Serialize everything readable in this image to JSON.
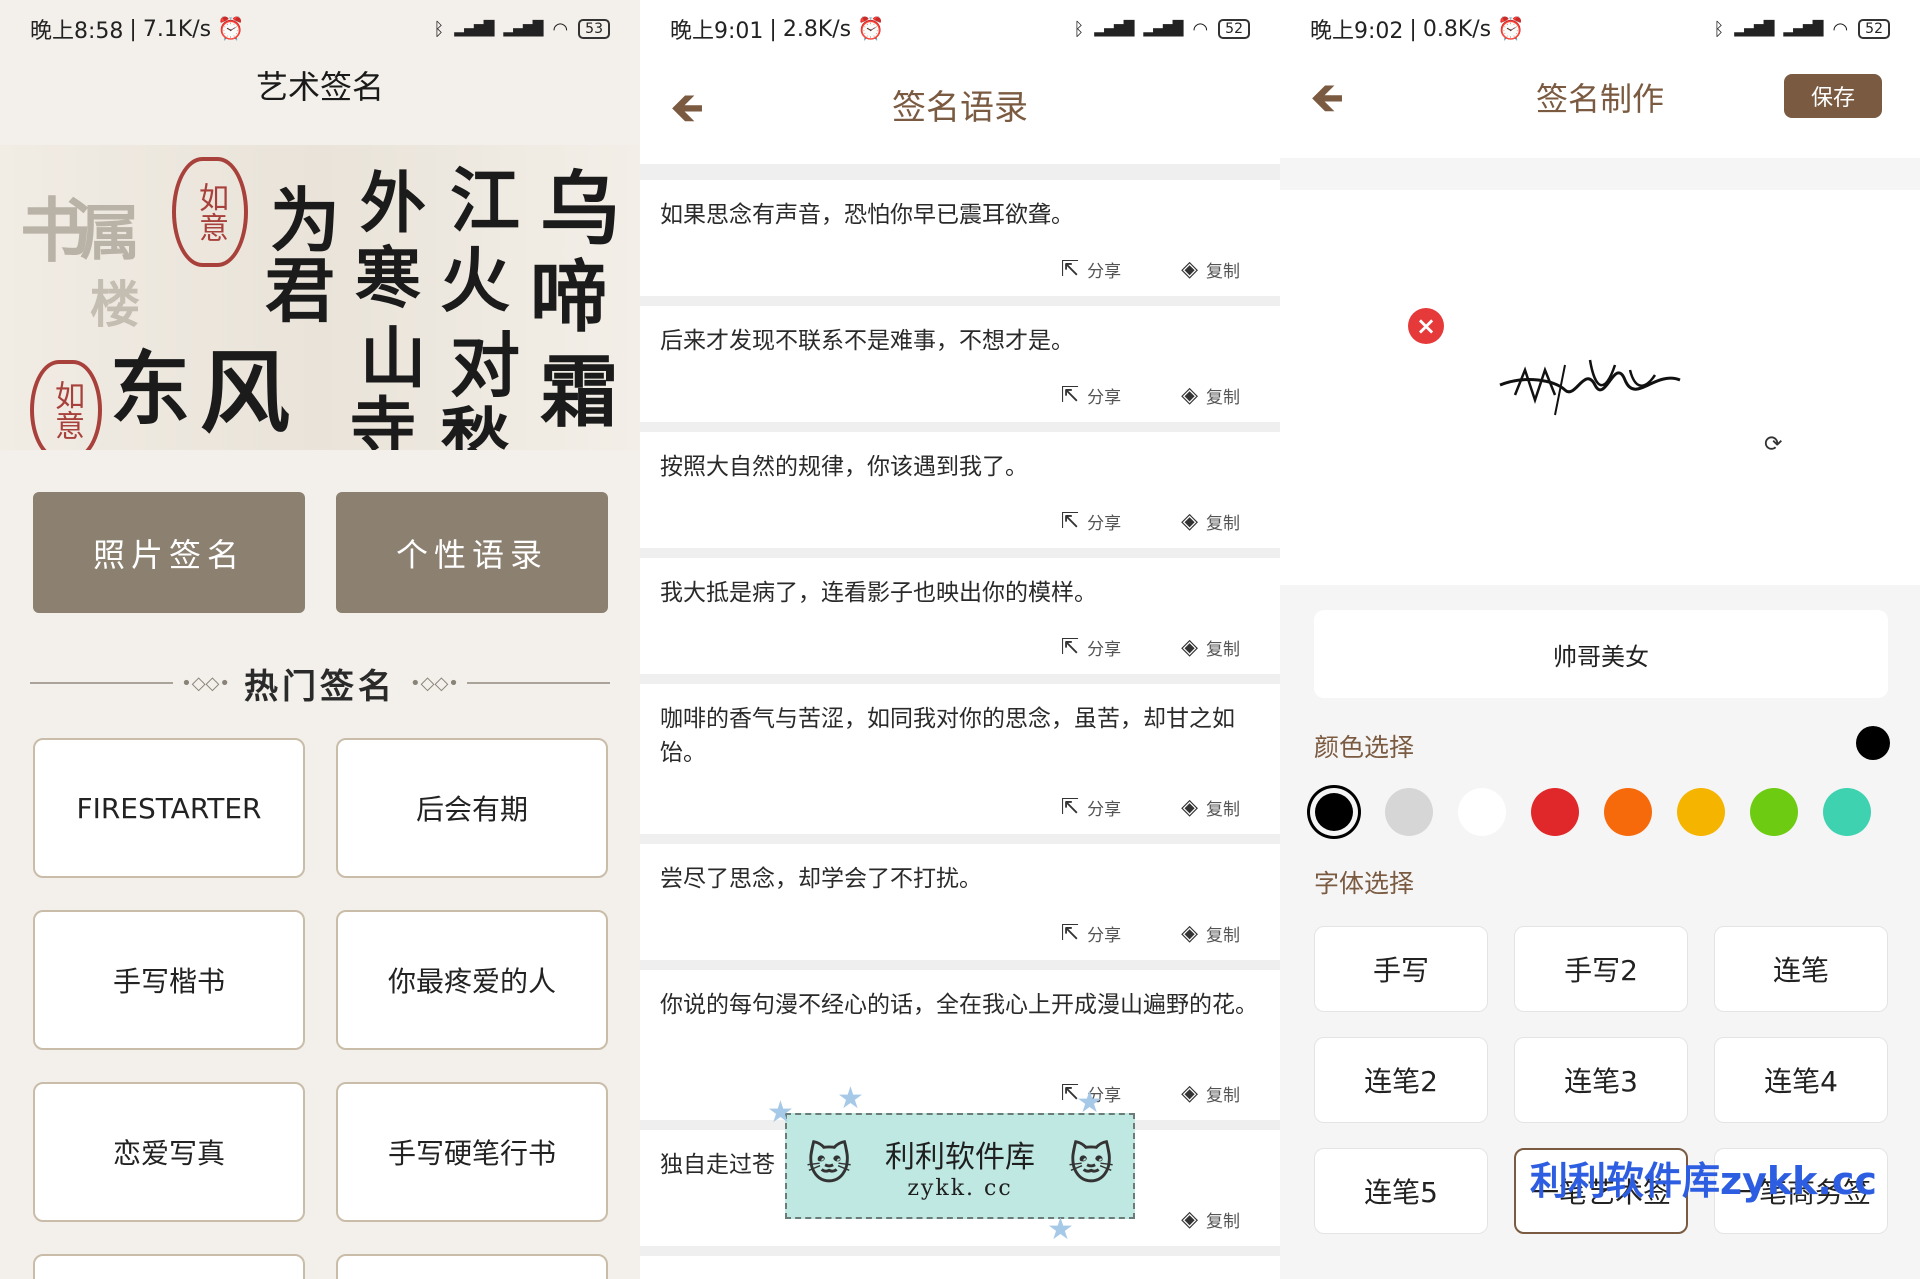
{
  "panel1": {
    "status": {
      "time": "晚上8:58",
      "speed": "7.1K/s",
      "battery": "53"
    },
    "title": "艺术签名",
    "buttons": {
      "photo": "照片签名",
      "quotes": "个性语录"
    },
    "section_title": "热门签名",
    "cards": [
      "FIRESTARTER",
      "后会有期",
      "手写楷书",
      "你最疼爱的人",
      "恋爱写真",
      "手写硬笔行书"
    ]
  },
  "panel2": {
    "status": {
      "time": "晚上9:01",
      "speed": "2.8K/s",
      "battery": "52"
    },
    "title": "签名语录",
    "share_label": "分享",
    "copy_label": "复制",
    "quotes": [
      "如果思念有声音，恐怕你早已震耳欲聋。",
      "后来才发现不联系不是难事，不想才是。",
      "按照大自然的规律，你该遇到我了。",
      "我大抵是病了，连看影子也映出你的模样。",
      "咖啡的香气与苦涩，如同我对你的思念，虽苦，却甘之如饴。",
      "尝尽了思念，却学会了不打扰。",
      "你说的每句漫不经心的话，全在我心上开成漫山遍野的花。",
      "独自走过苍"
    ],
    "watermark": {
      "line1": "利利软件库",
      "line2": "zykk. cc"
    }
  },
  "panel3": {
    "status": {
      "time": "晚上9:02",
      "speed": "0.8K/s",
      "battery": "52"
    },
    "title": "签名制作",
    "save_label": "保存",
    "input_value": "帅哥美女",
    "color_label": "颜色选择",
    "font_label": "字体选择",
    "colors": [
      "#000000",
      "#d6d6d6",
      "#ffffff",
      "#e0282a",
      "#f66a0c",
      "#f5b400",
      "#6dcc12",
      "#3fd2b0"
    ],
    "fonts": [
      "手写",
      "手写2",
      "连笔",
      "连笔2",
      "连笔3",
      "连笔4",
      "连笔5",
      "一笔艺术签",
      "一笔商务签"
    ],
    "watermark": "利利软件库zykk.cc"
  }
}
